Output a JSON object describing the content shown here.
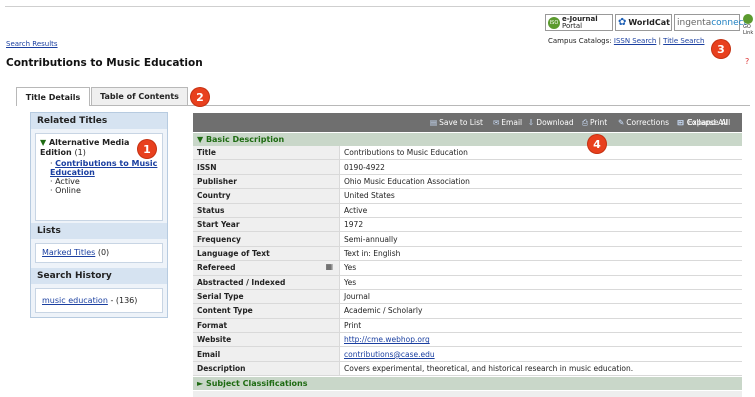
{
  "header": {
    "search_results_link": "Search Results",
    "page_title": "Contributions to Music Education",
    "campus_catalogs_label": "Campus Catalogs:",
    "issn_search_link": "ISSN Search",
    "separator": "|",
    "title_search_link": "Title Search",
    "help_symbol": "?"
  },
  "logos": {
    "ejournal_top": "e-Journal",
    "ejournal_bottom": "Portal",
    "worldcat": "WorldCat",
    "ingenta_prefix": "ingenta",
    "ingenta_suffix": "connect",
    "gl_text": "GO Link"
  },
  "tabs": [
    {
      "label": "Title Details",
      "active": true
    },
    {
      "label": "Table of Contents",
      "active": false
    }
  ],
  "sidebar": {
    "related_titles_heading": "Related Titles",
    "related_item_title": "Alternative Media Edition",
    "related_item_count": "(1)",
    "related_sub_link": "Contributions to Music Education",
    "related_sub_status1": "Active",
    "related_sub_status2": "Online",
    "lists_heading": "Lists",
    "marked_titles_link": "Marked Titles",
    "marked_titles_count": "(0)",
    "search_history_heading": "Search History",
    "history_link": "music education",
    "history_count": "- (136)"
  },
  "toolbar": {
    "save": "Save to List",
    "email": "Email",
    "download": "Download",
    "print": "Print",
    "corrections": "Corrections",
    "expand": "Expand All",
    "collapse": "Collapse All"
  },
  "sections": {
    "basic": "▼ Basic Description",
    "subject": "► Subject Classifications"
  },
  "details": [
    {
      "label": "Title",
      "value": "Contributions to Music Education"
    },
    {
      "label": "ISSN",
      "value": "0190-4922"
    },
    {
      "label": "Publisher",
      "value": "Ohio Music Education Association"
    },
    {
      "label": "Country",
      "value": "United States"
    },
    {
      "label": "Status",
      "value": "Active"
    },
    {
      "label": "Start Year",
      "value": "1972"
    },
    {
      "label": "Frequency",
      "value": "Semi-annually"
    },
    {
      "label": "Language of Text",
      "value": "Text in: English"
    },
    {
      "label": "Refereed",
      "value": "Yes"
    },
    {
      "label": "Abstracted / Indexed",
      "value": "Yes"
    },
    {
      "label": "Serial Type",
      "value": "Journal"
    },
    {
      "label": "Content Type",
      "value": "Academic / Scholarly"
    },
    {
      "label": "Format",
      "value": "Print"
    },
    {
      "label": "Website",
      "value": "http://cme.webhop.org"
    },
    {
      "label": "Email",
      "value": "contributions@case.edu"
    },
    {
      "label": "Description",
      "value": "Covers experimental, theoretical, and historical research in music education."
    }
  ],
  "callouts": [
    "1",
    "2",
    "3",
    "4"
  ],
  "colors": {
    "accent_badge": "#e8401e",
    "section_green": "#1e6b12",
    "toolbar": "#6f6f6f"
  }
}
